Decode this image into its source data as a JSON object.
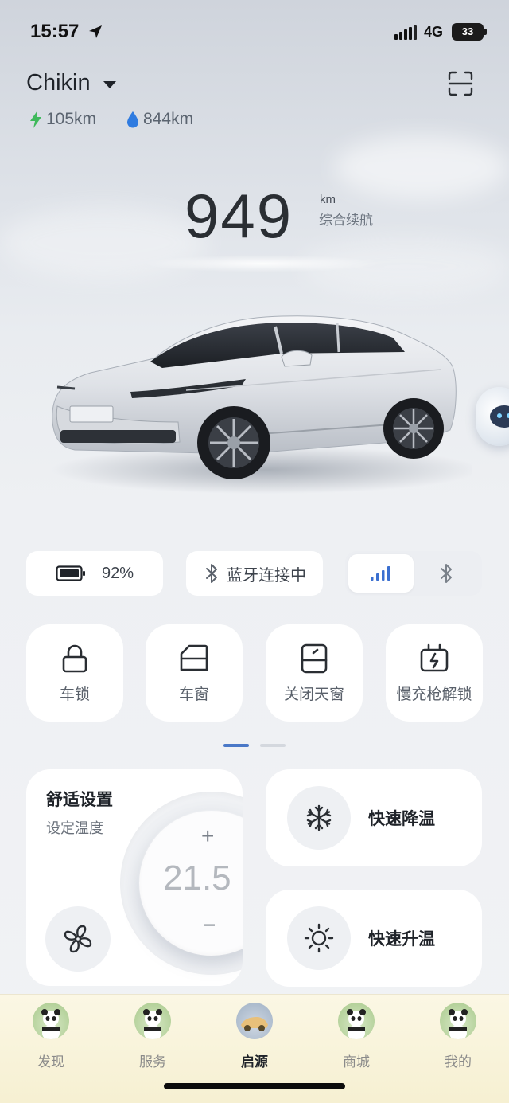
{
  "status_bar": {
    "time": "15:57",
    "network": "4G",
    "battery": "33"
  },
  "header": {
    "vehicle_name": "Chikin",
    "electric_range": "105km",
    "fuel_range": "844km"
  },
  "range": {
    "total": "949",
    "unit": "km",
    "label": "综合续航"
  },
  "status_pills": {
    "battery_percent": "92%",
    "bluetooth_status": "蓝牙连接中"
  },
  "quick_controls": [
    {
      "label": "车锁",
      "icon": "lock-icon"
    },
    {
      "label": "车窗",
      "icon": "car-window-icon"
    },
    {
      "label": "关闭天窗",
      "icon": "sunroof-icon"
    },
    {
      "label": "慢充枪解锁",
      "icon": "charger-unlock-icon"
    }
  ],
  "comfort": {
    "title": "舒适设置",
    "subtitle": "设定温度",
    "temperature": "21.5",
    "plus": "+",
    "minus": "−"
  },
  "climate": {
    "cool_label": "快速降温",
    "heat_label": "快速升温"
  },
  "tabs": [
    {
      "label": "发现"
    },
    {
      "label": "服务"
    },
    {
      "label": "启源"
    },
    {
      "label": "商城"
    },
    {
      "label": "我的"
    }
  ],
  "colors": {
    "accent_blue": "#4a78c7",
    "electric_green": "#3fb95b",
    "fuel_blue": "#2f7be0",
    "tabbar_bg": "#f8f3dc"
  }
}
